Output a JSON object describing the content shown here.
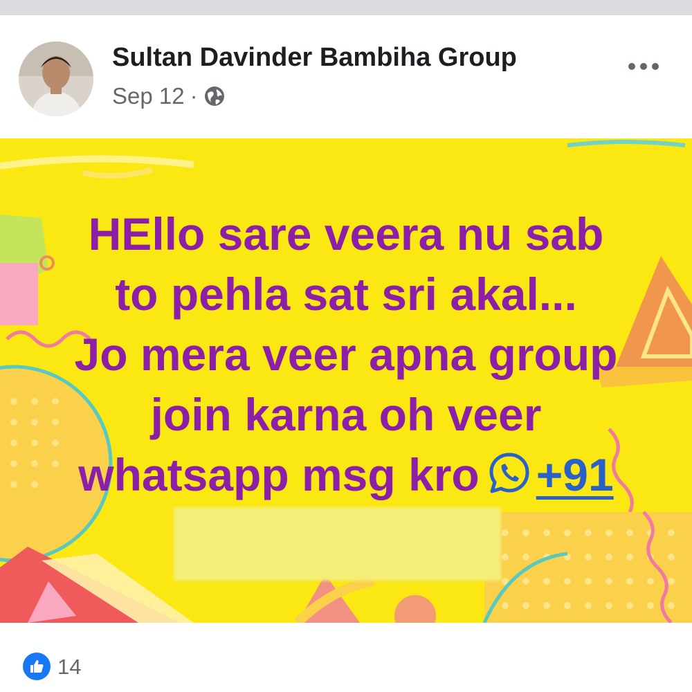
{
  "post": {
    "author": "Sultan Davinder Bambiha Group",
    "date": "Sep 12",
    "separator": "·",
    "privacy_icon": "globe-icon",
    "more_icon": "more-options-icon"
  },
  "banner": {
    "background_color": "#fbe712",
    "text_color": "#8b1fa8",
    "link_color": "#2a61c9",
    "lines": [
      "HEllo sare veera nu sab",
      "to pehla sat sri akal...",
      "Jo mera veer apna group",
      "join karna oh veer",
      "whatsapp msg kro"
    ],
    "whatsapp_icon": "whatsapp-icon",
    "phone_prefix": "+91"
  },
  "reactions": {
    "icon": "like-icon",
    "count": "14"
  }
}
